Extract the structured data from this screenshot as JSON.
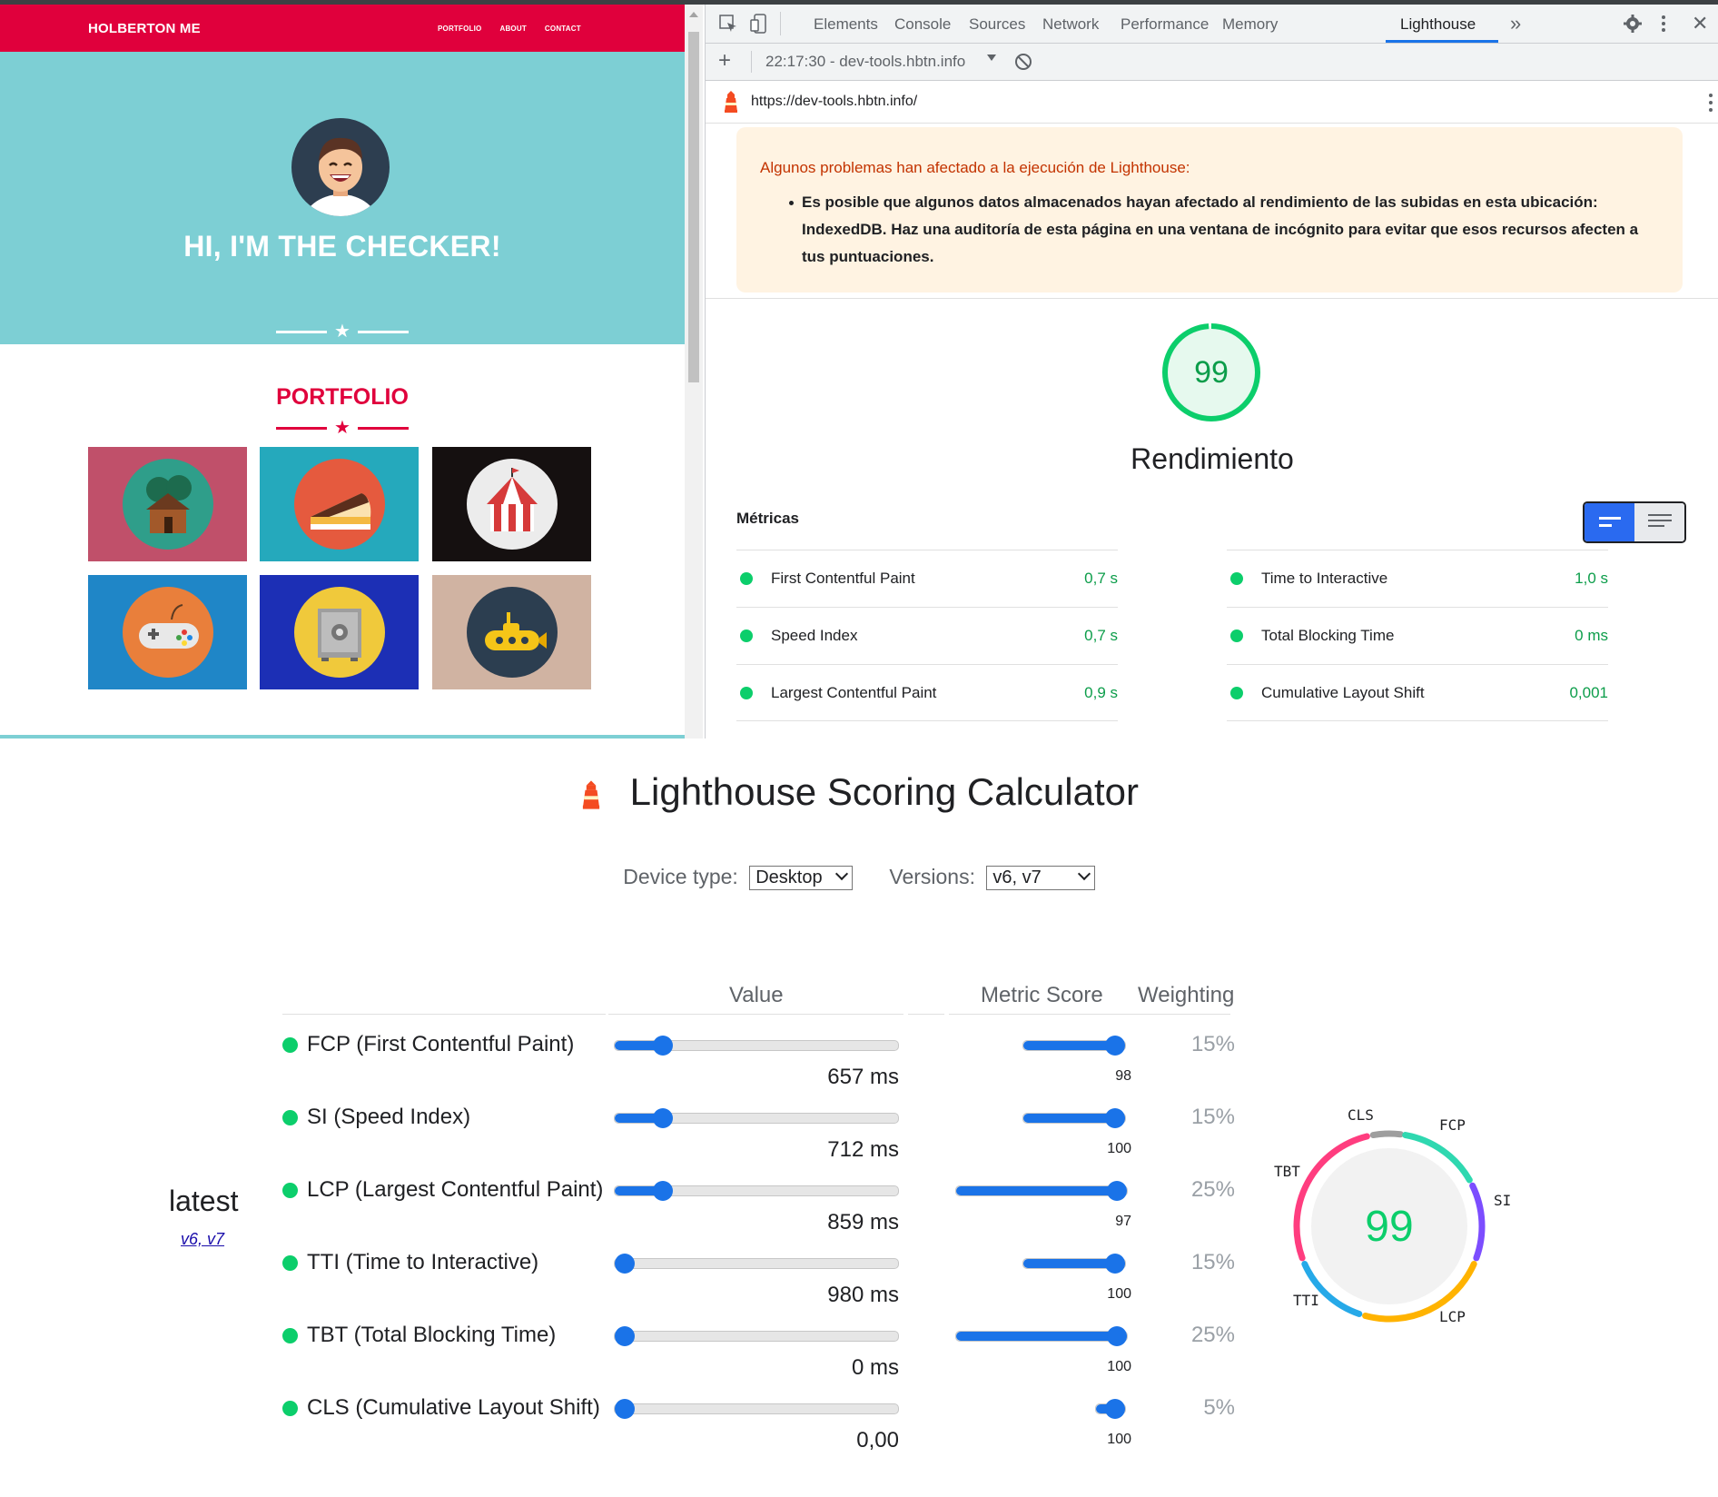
{
  "site": {
    "brand": "HOLBERTON ME",
    "nav": [
      "PORTFOLIO",
      "ABOUT",
      "CONTACT"
    ],
    "hero_title": "HI, I'M THE CHECKER!",
    "portfolio_title": "PORTFOLIO",
    "tile_colors": [
      "#c0506a",
      "#25a9bc",
      "#151010",
      "#1f86c7",
      "#1c2fb5",
      "#d0b3a2"
    ]
  },
  "devtools": {
    "tabs": [
      "Elements",
      "Console",
      "Sources",
      "Network",
      "Performance",
      "Memory",
      "Lighthouse"
    ],
    "active_tab": "Lighthouse",
    "report_select": "22:17:30 - dev-tools.hbtn.info",
    "url": "https://dev-tools.hbtn.info/",
    "warning_title": "Algunos problemas han afectado a la ejecución de Lighthouse:",
    "warning_text": "Es posible que algunos datos almacenados hayan afectado al rendimiento de las subidas en esta ubicación: IndexedDB. Haz una auditoría de esta página en una ventana de incógnito para evitar que esos recursos afecten a tus puntuaciones.",
    "score": "99",
    "score_label": "Rendimiento",
    "metrics_title": "Métricas",
    "metrics": [
      {
        "label": "First Contentful Paint",
        "value": "0,7 s"
      },
      {
        "label": "Time to Interactive",
        "value": "1,0 s"
      },
      {
        "label": "Speed Index",
        "value": "0,7 s"
      },
      {
        "label": "Total Blocking Time",
        "value": "0 ms"
      },
      {
        "label": "Largest Contentful Paint",
        "value": "0,9 s"
      },
      {
        "label": "Cumulative Layout Shift",
        "value": "0,001"
      }
    ]
  },
  "calculator": {
    "title": "Lighthouse Scoring Calculator",
    "device_label": "Device type:",
    "device_value": "Desktop",
    "versions_label": "Versions:",
    "versions_value": "v6, v7",
    "col_value": "Value",
    "col_score": "Metric Score",
    "col_weight": "Weighting",
    "version_name": "latest",
    "version_link": "v6, v7",
    "total_score": "99",
    "rows": [
      {
        "label": "FCP (First Contentful Paint)",
        "value": "657 ms",
        "score": "98",
        "weight": "15%",
        "value_frac": 0.17,
        "score_frac": 0.98
      },
      {
        "label": "SI (Speed Index)",
        "value": "712 ms",
        "score": "100",
        "weight": "15%",
        "value_frac": 0.17,
        "score_frac": 1.0
      },
      {
        "label": "LCP (Largest Contentful Paint)",
        "value": "859 ms",
        "score": "97",
        "weight": "25%",
        "value_frac": 0.17,
        "score_frac": 0.97
      },
      {
        "label": "TTI (Time to Interactive)",
        "value": "980 ms",
        "score": "100",
        "weight": "15%",
        "value_frac": 0.0,
        "score_frac": 1.0
      },
      {
        "label": "TBT (Total Blocking Time)",
        "value": "0 ms",
        "score": "100",
        "weight": "25%",
        "value_frac": 0.0,
        "score_frac": 1.0
      },
      {
        "label": "CLS (Cumulative Layout Shift)",
        "value": "0,00",
        "score": "100",
        "weight": "5%",
        "value_frac": 0.0,
        "score_frac": 1.0
      }
    ],
    "ring_labels": [
      "CLS",
      "FCP",
      "SI",
      "LCP",
      "TTI",
      "TBT"
    ],
    "ring_colors": {
      "CLS": "#9e9e9e",
      "FCP": "#2fd8b0",
      "SI": "#7c4dff",
      "LCP": "#ffb300",
      "TTI": "#26a9e8",
      "TBT": "#ff3d7f"
    }
  }
}
